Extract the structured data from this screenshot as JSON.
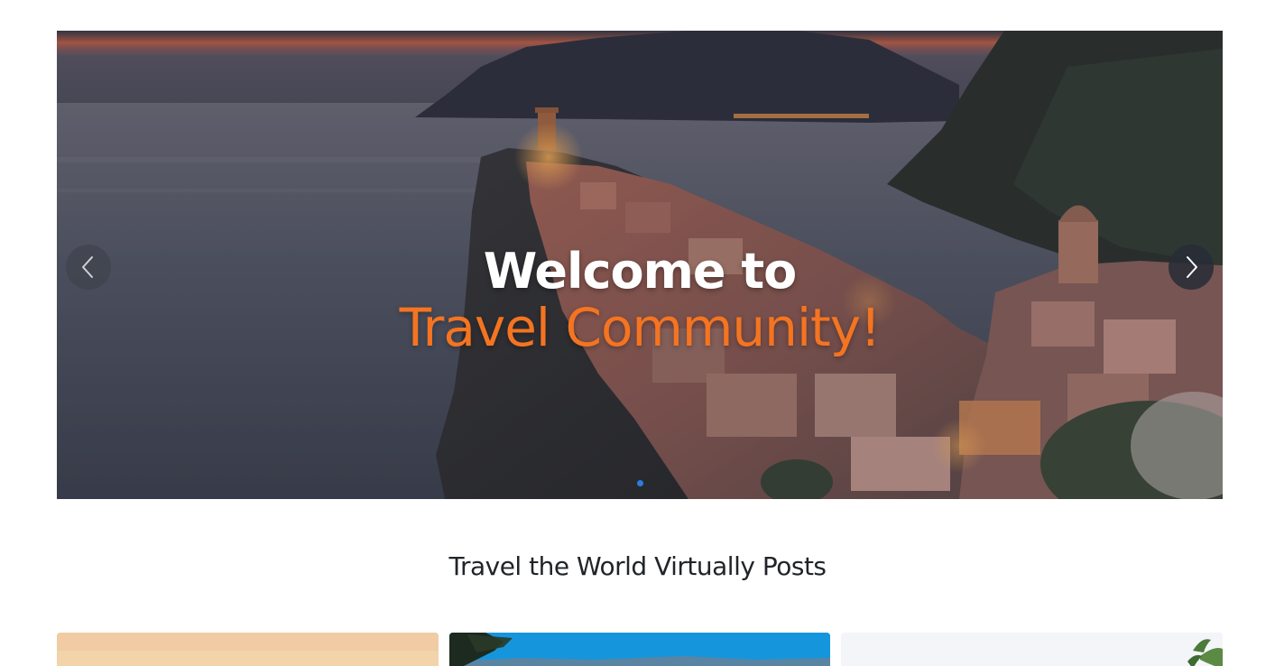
{
  "hero": {
    "title_line1": "Welcome to",
    "title_line2": "Travel Community!",
    "accent_color": "#f47421",
    "prev_icon": "chevron-left-icon",
    "next_icon": "chevron-right-icon",
    "slide_count": 1,
    "active_slide": 1
  },
  "section": {
    "title": "Travel the World Virtually Posts"
  },
  "cards": [
    {
      "image": "beach-sunset-image"
    },
    {
      "image": "coastal-blue-sky-image"
    },
    {
      "image": "white-sky-plant-image"
    }
  ]
}
